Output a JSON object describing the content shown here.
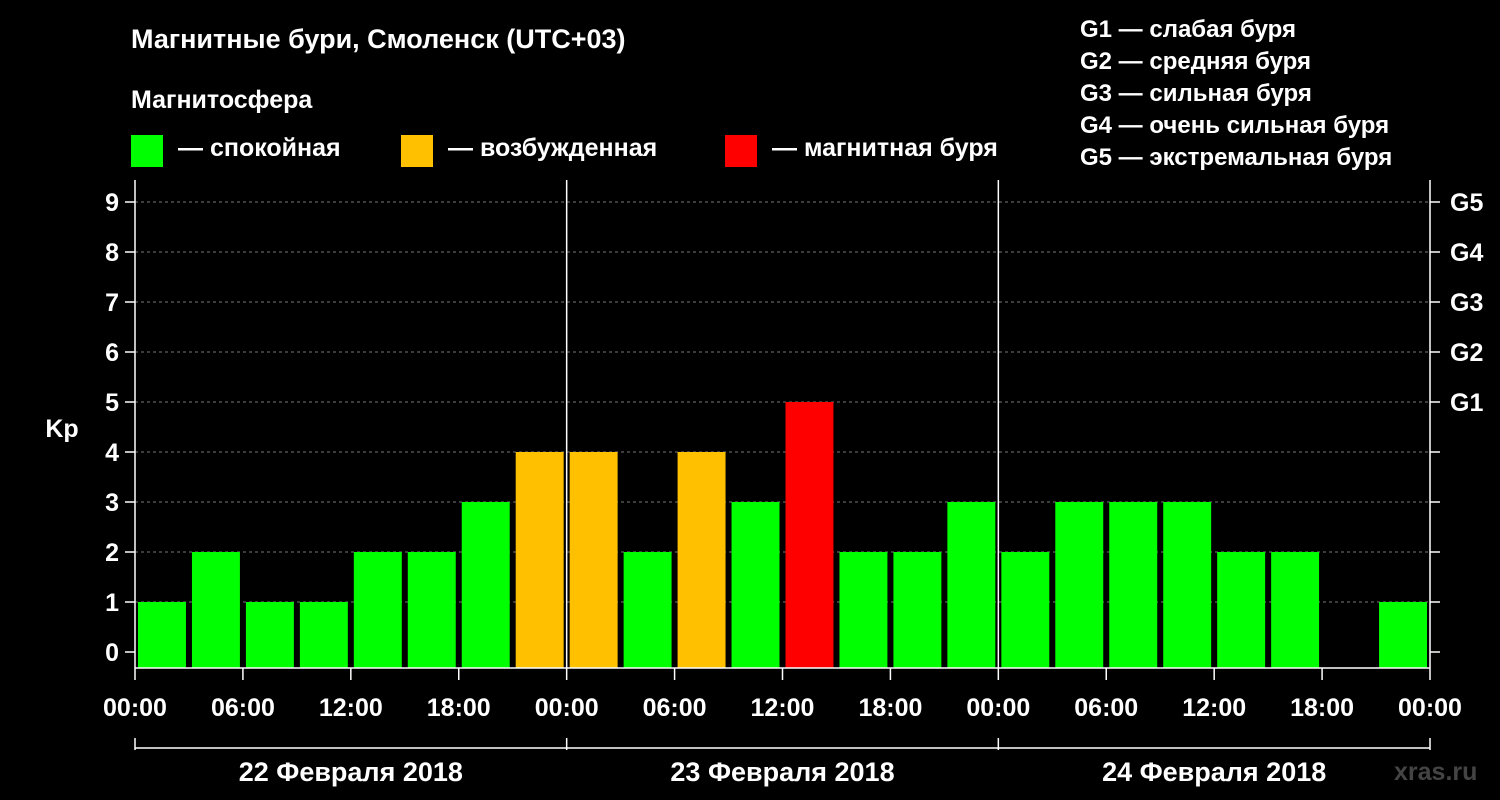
{
  "title": "Магнитные бури, Смоленск (UTC+03)",
  "subtitle": "Магнитосфера",
  "legend": [
    {
      "label": "— спокойная",
      "color": "#00ff00"
    },
    {
      "label": "— возбужденная",
      "color": "#ffc000"
    },
    {
      "label": "— магнитная буря",
      "color": "#ff0000"
    }
  ],
  "storm_scale": [
    "G1 — слабая буря",
    "G2 — средняя буря",
    "G3 — сильная буря",
    "G4 — очень сильная буря",
    "G5 — экстремальная буря"
  ],
  "credit": "xras.ru",
  "chart_data": {
    "type": "bar",
    "ylabel": "Kp",
    "ylim": [
      0,
      9
    ],
    "y_ticks": [
      "0",
      "1",
      "2",
      "3",
      "4",
      "5",
      "6",
      "7",
      "8",
      "9"
    ],
    "right_ticks": [
      {
        "value": 5,
        "label": "G1"
      },
      {
        "value": 6,
        "label": "G2"
      },
      {
        "value": 7,
        "label": "G3"
      },
      {
        "value": 8,
        "label": "G4"
      },
      {
        "value": 9,
        "label": "G5"
      }
    ],
    "x_tick_labels": [
      "00:00",
      "06:00",
      "12:00",
      "18:00",
      "00:00",
      "06:00",
      "12:00",
      "18:00",
      "00:00",
      "06:00",
      "12:00",
      "18:00",
      "00:00"
    ],
    "days": [
      "22 Февраля 2018",
      "23 Февраля 2018",
      "24 Февраля 2018"
    ],
    "grid": true,
    "interval_hours": 3,
    "values": [
      1,
      2,
      1,
      1,
      2,
      2,
      3,
      4,
      4,
      2,
      4,
      3,
      5,
      2,
      2,
      3,
      2,
      3,
      3,
      3,
      2,
      2,
      0,
      1
    ],
    "colors": [
      "#00ff00",
      "#00ff00",
      "#00ff00",
      "#00ff00",
      "#00ff00",
      "#00ff00",
      "#00ff00",
      "#ffc000",
      "#ffc000",
      "#00ff00",
      "#ffc000",
      "#00ff00",
      "#ff0000",
      "#00ff00",
      "#00ff00",
      "#00ff00",
      "#00ff00",
      "#00ff00",
      "#00ff00",
      "#00ff00",
      "#00ff00",
      "#00ff00",
      "#00ff00",
      "#00ff00"
    ]
  }
}
